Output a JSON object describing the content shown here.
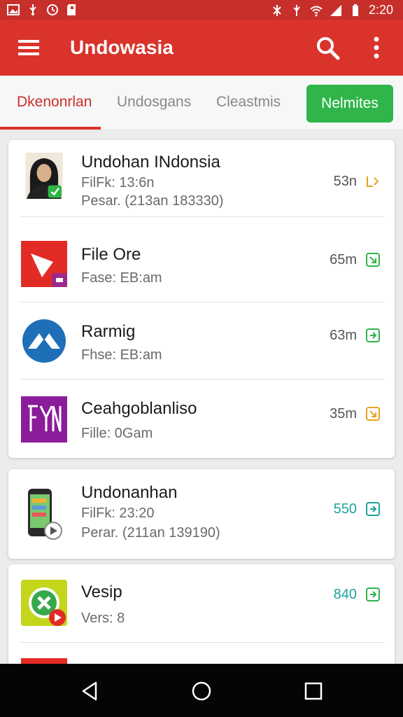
{
  "status_bar": {
    "time": "2:20",
    "left_icons": [
      "image-icon",
      "usb-icon",
      "sync-icon",
      "sd-card-icon"
    ],
    "right_icons": [
      "bluetooth-off-icon",
      "data-icon",
      "wifi-icon",
      "signal-icon",
      "battery-icon"
    ]
  },
  "app_bar": {
    "title": "Undowasia",
    "icons": [
      "menu-icon",
      "search-icon",
      "more-vert-icon"
    ]
  },
  "tabs": {
    "items": [
      {
        "label": "Dkenonrlan",
        "active": true
      },
      {
        "label": "Undosgans",
        "active": false
      },
      {
        "label": "Cleastmis",
        "active": false
      }
    ],
    "button_label": "Nelmites"
  },
  "colors": {
    "primary": "#d9332c",
    "accent_green": "#2fb54a",
    "teal": "#1fa39a"
  },
  "list": {
    "card1": [
      {
        "title": "Undohan INdonsia",
        "line1": "FilFk: 13:6n",
        "line2": "Pesar. (213an 183330)",
        "size": "53n",
        "icon": "avatar-photo-icon"
      },
      {
        "title": "File Ore",
        "line1": "Fase: EB:am",
        "size": "65m",
        "icon": "play-tag-icon"
      },
      {
        "title": "Rarmig",
        "line1": "Fhse: EB:am",
        "size": "63m",
        "icon": "mountain-logo-icon"
      },
      {
        "title": "Ceahgoblanliso",
        "line1": "Fille: 0Gam",
        "size": "35m",
        "icon": "purple-letters-icon"
      }
    ],
    "card2": [
      {
        "title": "Undonanhan",
        "line1": "FilFk: 23:20",
        "line2": "Perar. (211an 139190)",
        "size": "550",
        "icon": "phone-device-icon"
      }
    ],
    "card3": [
      {
        "title": "Vesip",
        "line1": "Vers: 8",
        "size": "840",
        "icon": "green-x-icon"
      }
    ]
  },
  "nav_bar": {
    "icons": [
      "back-icon",
      "home-icon",
      "recents-icon"
    ]
  }
}
